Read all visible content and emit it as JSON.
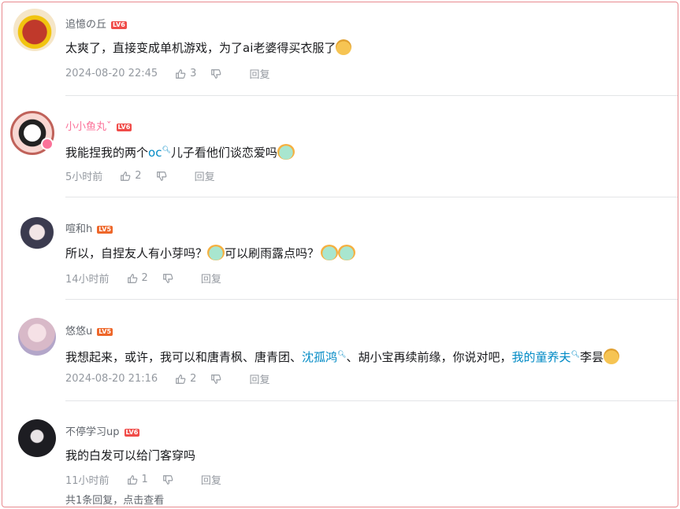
{
  "comments": [
    {
      "username": "追憶の丘",
      "level": "LV6",
      "text": "太爽了，直接变成单机游戏，为了ai老婆得买衣服了",
      "time": "2024-08-20 22:45",
      "likes": "3",
      "reply_label": "回复"
    },
    {
      "username": "小小鱼丸ˇ",
      "level": "LV6",
      "text_before": "我能捏我的两个",
      "link_text": "oc",
      "text_after": "儿子看他们谈恋爱吗",
      "time": "5小时前",
      "likes": "2",
      "reply_label": "回复"
    },
    {
      "username": "喧和h",
      "level": "LV5",
      "text_a": "所以，自捏友人有小芽吗？",
      "text_b": "可以刷雨露点吗？",
      "time": "14小时前",
      "likes": "2",
      "reply_label": "回复"
    },
    {
      "username": "悠悠u",
      "level": "LV5",
      "text_a": "我想起来，或许，我可以和唐青枫、唐青团、",
      "link1": "沈孤鸿",
      "text_b": "、胡小宝再续前缘，你说对吧，",
      "link2": "我的童养夫",
      "text_c": "李昙",
      "time": "2024-08-20 21:16",
      "likes": "2",
      "reply_label": "回复"
    },
    {
      "username": "不停学习up",
      "level": "LV6",
      "text": "我的白发可以给门客穿吗",
      "time": "11小时前",
      "likes": "1",
      "reply_label": "回复",
      "reply_count_text": "共1条回复，点击查看"
    }
  ],
  "colors": {
    "frame_border": "#e88a8f",
    "link": "#008ac5",
    "pink_name": "#fb7299",
    "level_badge": "#f04c49"
  }
}
